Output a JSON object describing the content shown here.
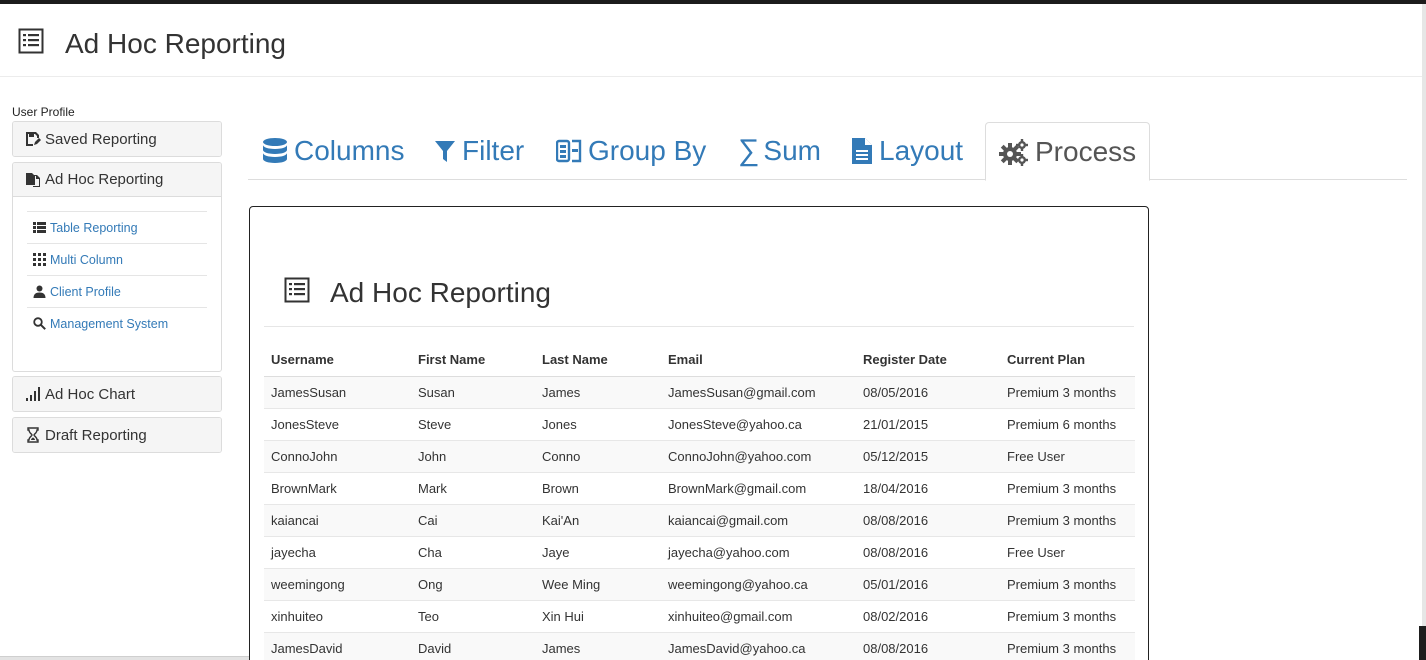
{
  "header": {
    "title": "Ad Hoc Reporting",
    "icon": "report-list-icon"
  },
  "sidebar": {
    "label": "User Profile",
    "panels": [
      {
        "label": "Saved Reporting",
        "icon": "save-report-icon",
        "expanded": false
      },
      {
        "label": "Ad Hoc Reporting",
        "icon": "copy-files-icon",
        "expanded": true,
        "items": [
          {
            "label": "Table Reporting",
            "icon": "table-list-icon"
          },
          {
            "label": "Multi Column",
            "icon": "grid-icon"
          },
          {
            "label": "Client Profile",
            "icon": "user-icon"
          },
          {
            "label": "Management System",
            "icon": "search-icon"
          }
        ]
      },
      {
        "label": "Ad Hoc Chart",
        "icon": "bar-signal-icon",
        "expanded": false
      },
      {
        "label": "Draft Reporting",
        "icon": "hourglass-icon",
        "expanded": false
      }
    ]
  },
  "tabs": [
    {
      "label": "Columns",
      "icon": "database-icon"
    },
    {
      "label": "Filter",
      "icon": "filter-icon"
    },
    {
      "label": "Group By",
      "icon": "group-icon"
    },
    {
      "label": "Sum",
      "icon": "sigma-icon"
    },
    {
      "label": "Layout",
      "icon": "document-icon"
    },
    {
      "label": "Process",
      "icon": "gears-icon",
      "active": true
    }
  ],
  "report": {
    "title": "Ad Hoc Reporting",
    "columns": [
      "Username",
      "First Name",
      "Last Name",
      "Email",
      "Register Date",
      "Current Plan"
    ],
    "rows": [
      [
        "JamesSusan",
        "Susan",
        "James",
        "JamesSusan@gmail.com",
        "08/05/2016",
        "Premium 3 months"
      ],
      [
        "JonesSteve",
        "Steve",
        "Jones",
        "JonesSteve@yahoo.ca",
        "21/01/2015",
        "Premium 6 months"
      ],
      [
        "ConnoJohn",
        "John",
        "Conno",
        "ConnoJohn@yahoo.com",
        "05/12/2015",
        "Free User"
      ],
      [
        "BrownMark",
        "Mark",
        "Brown",
        "BrownMark@gmail.com",
        "18/04/2016",
        "Premium 3 months"
      ],
      [
        "kaiancai",
        "Cai",
        "Kai'An",
        "kaiancai@gmail.com",
        "08/08/2016",
        "Premium 3 months"
      ],
      [
        "jayecha",
        "Cha",
        "Jaye",
        "jayecha@yahoo.com",
        "08/08/2016",
        "Free User"
      ],
      [
        "weemingong",
        "Ong",
        "Wee Ming",
        "weemingong@yahoo.ca",
        "05/01/2016",
        "Premium 3 months"
      ],
      [
        "xinhuiteo",
        "Teo",
        "Xin Hui",
        "xinhuiteo@gmail.com",
        "08/02/2016",
        "Premium 3 months"
      ],
      [
        "JamesDavid",
        "David",
        "James",
        "JamesDavid@yahoo.ca",
        "08/08/2016",
        "Premium 3 months"
      ]
    ]
  },
  "colors": {
    "link": "#337ab7",
    "active_tab_text": "#555555",
    "text": "#333333"
  }
}
